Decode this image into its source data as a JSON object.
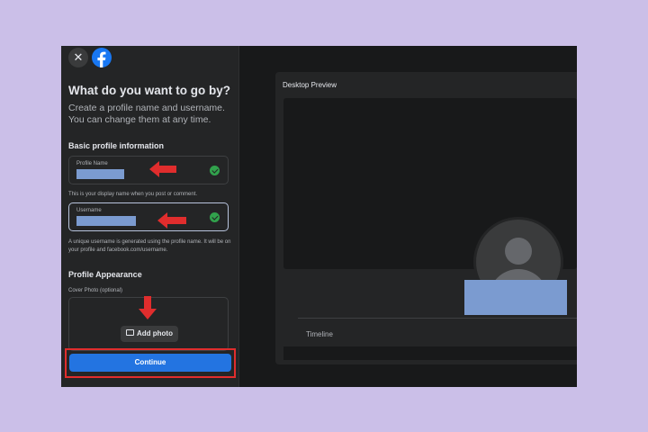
{
  "header": {
    "close_icon": "close-icon",
    "logo_icon": "facebook-logo-icon"
  },
  "form": {
    "title": "What do you want to go by?",
    "subtitle": "Create a profile name and username. You can change them at any time.",
    "basic_section": "Basic profile information",
    "profile_name": {
      "label": "Profile Name",
      "value_redacted": true,
      "valid": true,
      "hint": "This is your display name when you post or comment."
    },
    "username": {
      "label": "Username",
      "value_redacted": true,
      "valid": true,
      "hint": "A unique username is generated using the profile name. It will be on your profile and facebook.com/username."
    },
    "appearance_section": "Profile Appearance",
    "cover_label": "Cover Photo (optional)",
    "add_photo_label": "Add photo",
    "continue_label": "Continue"
  },
  "preview": {
    "title": "Desktop Preview",
    "timeline_label": "Timeline"
  },
  "colors": {
    "accent": "#2374e1",
    "annotation_red": "#e02d2d",
    "valid_green": "#31a24c",
    "redaction_blue": "#7b9bd0",
    "page_background": "#cbbfe8"
  }
}
